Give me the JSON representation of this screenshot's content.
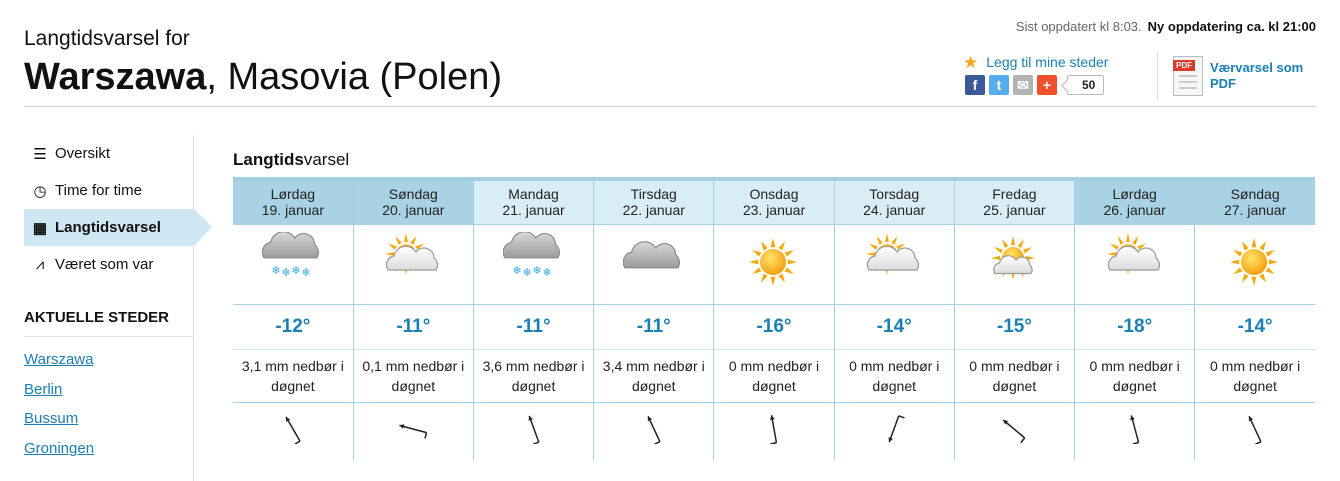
{
  "header": {
    "subtitle": "Langtidsvarsel for",
    "city": "Warszawa",
    "region": ", Masovia (Polen)",
    "updated": "Sist oppdatert kl 8:03.",
    "next_update": "Ny oppdatering ca. kl 21:00",
    "add_fav": "Legg til mine steder",
    "share_count": "50",
    "pdf_link": "Værvarsel som PDF",
    "pdf_tag": "PDF",
    "share_icons": [
      {
        "name": "facebook-icon",
        "label": "f",
        "color": "#3b5998"
      },
      {
        "name": "twitter-icon",
        "label": "t",
        "color": "#55acee"
      },
      {
        "name": "email-icon",
        "label": "✉",
        "color": "#b3b3b3"
      },
      {
        "name": "addthis-icon",
        "label": "+",
        "color": "#f0502b"
      }
    ]
  },
  "sidebar": {
    "nav": [
      {
        "label": "Oversikt",
        "icon": "list-icon",
        "glyph": "☰",
        "active": false
      },
      {
        "label": "Time for time",
        "icon": "clock-icon",
        "glyph": "◷",
        "active": false
      },
      {
        "label": "Langtidsvarsel",
        "icon": "calendar-icon",
        "glyph": "▦",
        "active": true
      },
      {
        "label": "Været som var",
        "icon": "chart-icon",
        "glyph": "⩘",
        "active": false
      }
    ],
    "places_title": "AKTUELLE STEDER",
    "places": [
      "Warszawa",
      "Berlin",
      "Bussum",
      "Groningen"
    ]
  },
  "forecast": {
    "title_bold": "Langtids",
    "title_rest": "varsel",
    "days": [
      {
        "day": "Lørdag",
        "date": "19. januar",
        "weekend": true,
        "icon": "cloud-snow",
        "temp": "-12°",
        "precip": "3,1 mm nedbør i døgnet",
        "wind_deg": 240
      },
      {
        "day": "Søndag",
        "date": "20. januar",
        "weekend": true,
        "icon": "partly-cloudy",
        "temp": "-11°",
        "precip": "0,1 mm nedbør i døgnet",
        "wind_deg": 195
      },
      {
        "day": "Mandag",
        "date": "21. januar",
        "weekend": false,
        "icon": "cloud-snow",
        "temp": "-11°",
        "precip": "3,6 mm nedbør i døgnet",
        "wind_deg": 250
      },
      {
        "day": "Tirsdag",
        "date": "22. januar",
        "weekend": false,
        "icon": "cloudy",
        "temp": "-11°",
        "precip": "3,4 mm nedbør i døgnet",
        "wind_deg": 245
      },
      {
        "day": "Onsdag",
        "date": "23. januar",
        "weekend": false,
        "icon": "sun",
        "temp": "-16°",
        "precip": "0 mm nedbør i døgnet",
        "wind_deg": 260
      },
      {
        "day": "Torsdag",
        "date": "24. januar",
        "weekend": false,
        "icon": "partly-cloudy",
        "temp": "-14°",
        "precip": "0 mm nedbør i døgnet",
        "wind_deg": 110
      },
      {
        "day": "Fredag",
        "date": "25. januar",
        "weekend": false,
        "icon": "sun-cloud",
        "temp": "-15°",
        "precip": "0 mm nedbør i døgnet",
        "wind_deg": 220
      },
      {
        "day": "Lørdag",
        "date": "26. januar",
        "weekend": true,
        "icon": "partly-cloudy",
        "temp": "-18°",
        "precip": "0 mm nedbør i døgnet",
        "wind_deg": 255
      },
      {
        "day": "Søndag",
        "date": "27. januar",
        "weekend": true,
        "icon": "sun",
        "temp": "-14°",
        "precip": "0 mm nedbør i døgnet",
        "wind_deg": 245
      }
    ]
  },
  "colors": {
    "link": "#1a7fb5",
    "header_row": "#d9edf6",
    "weekend_row": "#a9d2e4",
    "border": "#a5cfe2"
  }
}
